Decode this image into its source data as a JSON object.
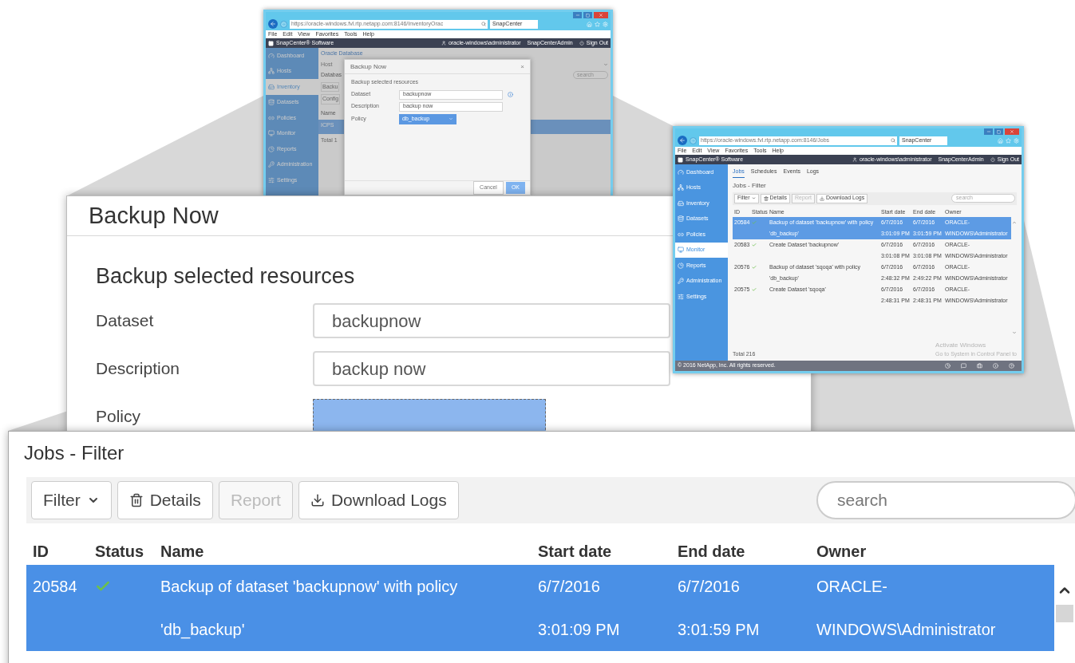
{
  "inventory_window": {
    "browser": {
      "url": "https://oracle-windows.fvl.rtp.netapp.com:8146/InventoryOrac",
      "tab": "SnapCenter",
      "menu": [
        "File",
        "Edit",
        "View",
        "Favorites",
        "Tools",
        "Help"
      ]
    },
    "app_header": {
      "product": "SnapCenter® Software",
      "user": "oracle-windows\\administrator",
      "role": "SnapCenterAdmin",
      "sign_out": "Sign Out"
    },
    "sidebar": [
      {
        "label": "Dashboard",
        "selected": false
      },
      {
        "label": "Hosts",
        "selected": false
      },
      {
        "label": "Inventory",
        "selected": true
      },
      {
        "label": "Datasets",
        "selected": false
      },
      {
        "label": "Policies",
        "selected": false
      },
      {
        "label": "Monitor",
        "selected": false
      },
      {
        "label": "Reports",
        "selected": false
      },
      {
        "label": "Administration",
        "selected": false
      },
      {
        "label": "Settings",
        "selected": false
      }
    ],
    "page": {
      "breadcrumb": "Oracle Database",
      "host_label": "Host",
      "section_title": "Databas",
      "toolbar": [
        "Backu",
        "Config"
      ],
      "column": "Name",
      "row": "ICPS",
      "total": "Total 1",
      "search_placeholder": "search"
    },
    "dialog": {
      "title": "Backup Now",
      "close": "×",
      "subtitle": "Backup selected resources",
      "fields": [
        {
          "label": "Dataset",
          "value": "backupnow",
          "kind": "text",
          "info": true
        },
        {
          "label": "Description",
          "value": "backup now",
          "kind": "text",
          "info": false
        },
        {
          "label": "Policy",
          "value": "db_backup",
          "kind": "select",
          "info": false
        }
      ],
      "buttons": [
        {
          "label": "Cancel",
          "kind": "secondary"
        },
        {
          "label": "OK",
          "kind": "primary"
        }
      ]
    }
  },
  "backup_callout": {
    "title": "Backup Now",
    "subtitle": "Backup selected resources",
    "fields": [
      {
        "label": "Dataset",
        "value": "backupnow",
        "kind": "text"
      },
      {
        "label": "Description",
        "value": "backup now",
        "kind": "text"
      },
      {
        "label": "Policy",
        "kind": "select"
      }
    ]
  },
  "jobs_window": {
    "browser": {
      "url": "https://oracle-windows.fvl.rtp.netapp.com:8146/Jobs",
      "tab": "SnapCenter",
      "menu": [
        "File",
        "Edit",
        "View",
        "Favorites",
        "Tools",
        "Help"
      ]
    },
    "app_header": {
      "product": "SnapCenter® Software",
      "user": "oracle-windows\\administrator",
      "role": "SnapCenterAdmin",
      "sign_out": "Sign Out"
    },
    "sidebar": [
      {
        "label": "Dashboard",
        "selected": false
      },
      {
        "label": "Hosts",
        "selected": false
      },
      {
        "label": "Inventory",
        "selected": false
      },
      {
        "label": "Datasets",
        "selected": false
      },
      {
        "label": "Policies",
        "selected": false
      },
      {
        "label": "Monitor",
        "selected": true
      },
      {
        "label": "Reports",
        "selected": false
      },
      {
        "label": "Administration",
        "selected": false
      },
      {
        "label": "Settings",
        "selected": false
      }
    ],
    "tabs": [
      {
        "label": "Jobs",
        "selected": true
      },
      {
        "label": "Schedules",
        "selected": false
      },
      {
        "label": "Events",
        "selected": false
      },
      {
        "label": "Logs",
        "selected": false
      }
    ],
    "title": "Jobs - Filter",
    "toolbar": [
      {
        "label": "Filter",
        "kind": "dropdown",
        "disabled": false
      },
      {
        "label": "Details",
        "kind": "button",
        "disabled": false
      },
      {
        "label": "Report",
        "kind": "button",
        "disabled": true
      },
      {
        "label": "Download Logs",
        "kind": "button",
        "disabled": false
      }
    ],
    "search_placeholder": "search",
    "columns": [
      "ID",
      "Status",
      "Name",
      "Start date",
      "End date",
      "Owner"
    ],
    "rows": [
      {
        "id": "20584",
        "success": true,
        "name": "Backup of dataset 'backupnow' with policy 'db_backup'",
        "start_date": "6/7/2016",
        "start_time": "3:01:09 PM",
        "end_date": "6/7/2016",
        "end_time": "3:01:59 PM",
        "owner": "ORACLE-WINDOWS\\Administrator",
        "selected": true
      },
      {
        "id": "20583",
        "success": true,
        "name": "Create Dataset 'backupnow'",
        "start_date": "6/7/2016",
        "start_time": "3:01:08 PM",
        "end_date": "6/7/2016",
        "end_time": "3:01:08 PM",
        "owner": "ORACLE-WINDOWS\\Administrator",
        "selected": false
      },
      {
        "id": "20576",
        "success": true,
        "name": "Backup of dataset 'sqoqa' with policy 'db_backup'",
        "start_date": "6/7/2016",
        "start_time": "2:48:32 PM",
        "end_date": "6/7/2016",
        "end_time": "2:49:22 PM",
        "owner": "ORACLE-WINDOWS\\Administrator",
        "selected": false
      },
      {
        "id": "20575",
        "success": true,
        "name": "Create Dataset 'sqoqa'",
        "start_date": "6/7/2016",
        "start_time": "2:48:31 PM",
        "end_date": "6/7/2016",
        "end_time": "2:48:31 PM",
        "owner": "ORACLE-WINDOWS\\Administrator",
        "selected": false
      }
    ],
    "total": "Total 216",
    "activation": {
      "title": "Activate Windows",
      "text": "Go to System in Control Panel to"
    },
    "footer": "© 2016 NetApp, Inc. All rights reserved."
  },
  "jobs_callout": {
    "title": "Jobs - Filter",
    "toolbar": [
      {
        "label": "Filter",
        "kind": "dropdown",
        "disabled": false
      },
      {
        "label": "Details",
        "kind": "button",
        "disabled": false
      },
      {
        "label": "Report",
        "kind": "button",
        "disabled": true
      },
      {
        "label": "Download Logs",
        "kind": "button",
        "disabled": false
      }
    ],
    "search_placeholder": "search",
    "columns": [
      "ID",
      "Status",
      "Name",
      "Start date",
      "End date",
      "Owner"
    ],
    "rows": [
      {
        "id": "20584",
        "success": true,
        "name": "Backup of dataset 'backupnow' with policy 'db_backup'",
        "start_date": "6/7/2016",
        "start_time": "3:01:09 PM",
        "end_date": "6/7/2016",
        "end_time": "3:01:59 PM",
        "owner": "ORACLE-WINDOWS\\Administrator",
        "selected": true
      }
    ]
  }
}
